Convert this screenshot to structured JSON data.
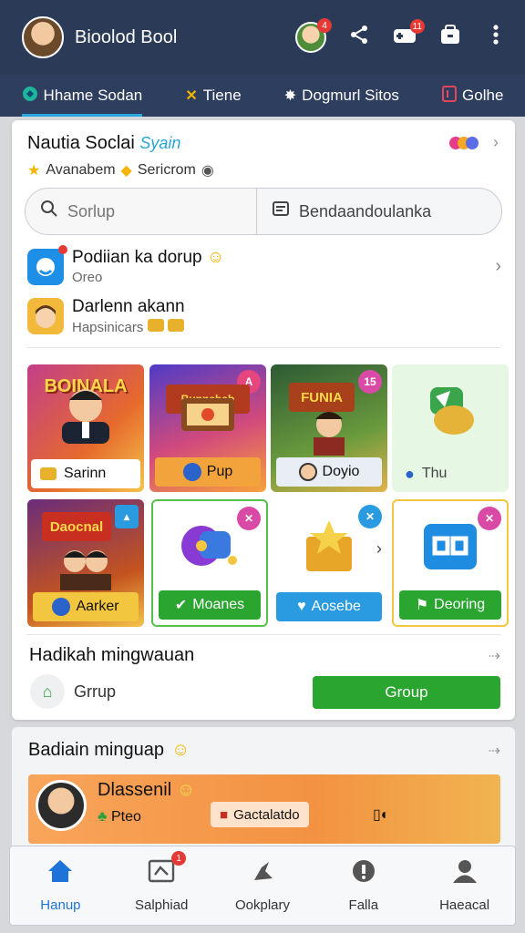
{
  "app": {
    "title": "Bioolod Bool",
    "notif_count_1": "4",
    "notif_count_2": "11"
  },
  "tabs": [
    {
      "label": "Hhame Sodan",
      "icon": "globe-icon",
      "active": true
    },
    {
      "label": "Tiene",
      "icon": "cross-icon"
    },
    {
      "label": "Dogmurl Sitos",
      "icon": "star-icon"
    },
    {
      "label": "Golhe",
      "icon": "bookmark-icon"
    }
  ],
  "card": {
    "title": "Nautia Soclai",
    "title_accent": "Syain",
    "subtitle_1": "Avanabem",
    "subtitle_2": "Sericrom"
  },
  "search": {
    "placeholder": "Sorlup",
    "right_label": "Bendaandoulanka"
  },
  "list": [
    {
      "title": "Podiian ka dorup",
      "subtitle": "Oreo"
    },
    {
      "title": "Darlenn akann",
      "subtitle": "Hapsinicars"
    }
  ],
  "tiles_row1": [
    {
      "banner": "BOINALA",
      "label": "Sarinn"
    },
    {
      "banner": "Bunnabab",
      "label": "Pup",
      "corner": "A"
    },
    {
      "banner": "FUNIA",
      "label": "Doyio",
      "corner": "15"
    },
    {
      "label": "Thu"
    }
  ],
  "tiles_row2": [
    {
      "banner": "Daocnal",
      "label": "Aarker"
    },
    {
      "label": "Moanes"
    },
    {
      "label": "Aosebe"
    },
    {
      "label": "Deoring"
    }
  ],
  "section": {
    "title": "Hadikah mingwauan",
    "group_label": "Grrup",
    "group_button": "Group"
  },
  "card2": {
    "title": "Badiain minguap",
    "name": "Dlassenil",
    "sub": "Pteo",
    "chip": "Gactalatdo"
  },
  "bottom_nav": [
    {
      "label": "Hanup",
      "icon": "home-icon",
      "active": true
    },
    {
      "label": "Salphiad",
      "icon": "inbox-icon",
      "badge": "1"
    },
    {
      "label": "Ookplary",
      "icon": "explore-icon"
    },
    {
      "label": "Falla",
      "icon": "info-icon"
    },
    {
      "label": "Haeacal",
      "icon": "person-icon"
    }
  ],
  "colors": {
    "topbar": "#2b3a57",
    "accent": "#2ba7e0",
    "green": "#2aa52f"
  }
}
